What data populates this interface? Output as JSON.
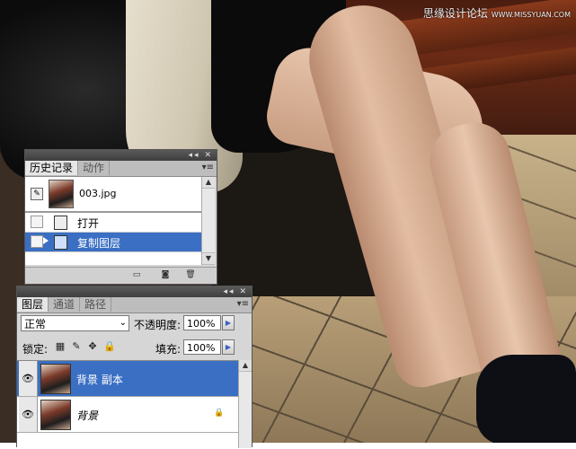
{
  "watermark": {
    "text": "思缘设计论坛",
    "site": "WWW.MISSYUAN.COM"
  },
  "history_panel": {
    "tabs": [
      "历史记录",
      "动作"
    ],
    "snapshot": {
      "name": "003.jpg"
    },
    "states": [
      {
        "label": "打开",
        "selected": false
      },
      {
        "label": "复制图层",
        "selected": true
      }
    ],
    "footer_icons": [
      "new-document-from-state-icon",
      "new-snapshot-icon",
      "trash-icon"
    ]
  },
  "layers_panel": {
    "tabs": [
      "图层",
      "通道",
      "路径"
    ],
    "blend_mode": "正常",
    "opacity_label": "不透明度:",
    "opacity_value": "100%",
    "lock_label": "锁定:",
    "fill_label": "填充:",
    "fill_value": "100%",
    "lock_icons": [
      "lock-transparent-icon",
      "lock-paint-icon",
      "lock-move-icon",
      "lock-all-icon"
    ],
    "layers": [
      {
        "name": "背景 副本",
        "selected": true,
        "visible": true,
        "locked": false
      },
      {
        "name": "背景",
        "selected": false,
        "visible": true,
        "locked": true
      }
    ]
  },
  "colors": {
    "selection": "#3a6fc3",
    "panel_bg": "#d6d6d6",
    "titlebar": "#444444"
  }
}
